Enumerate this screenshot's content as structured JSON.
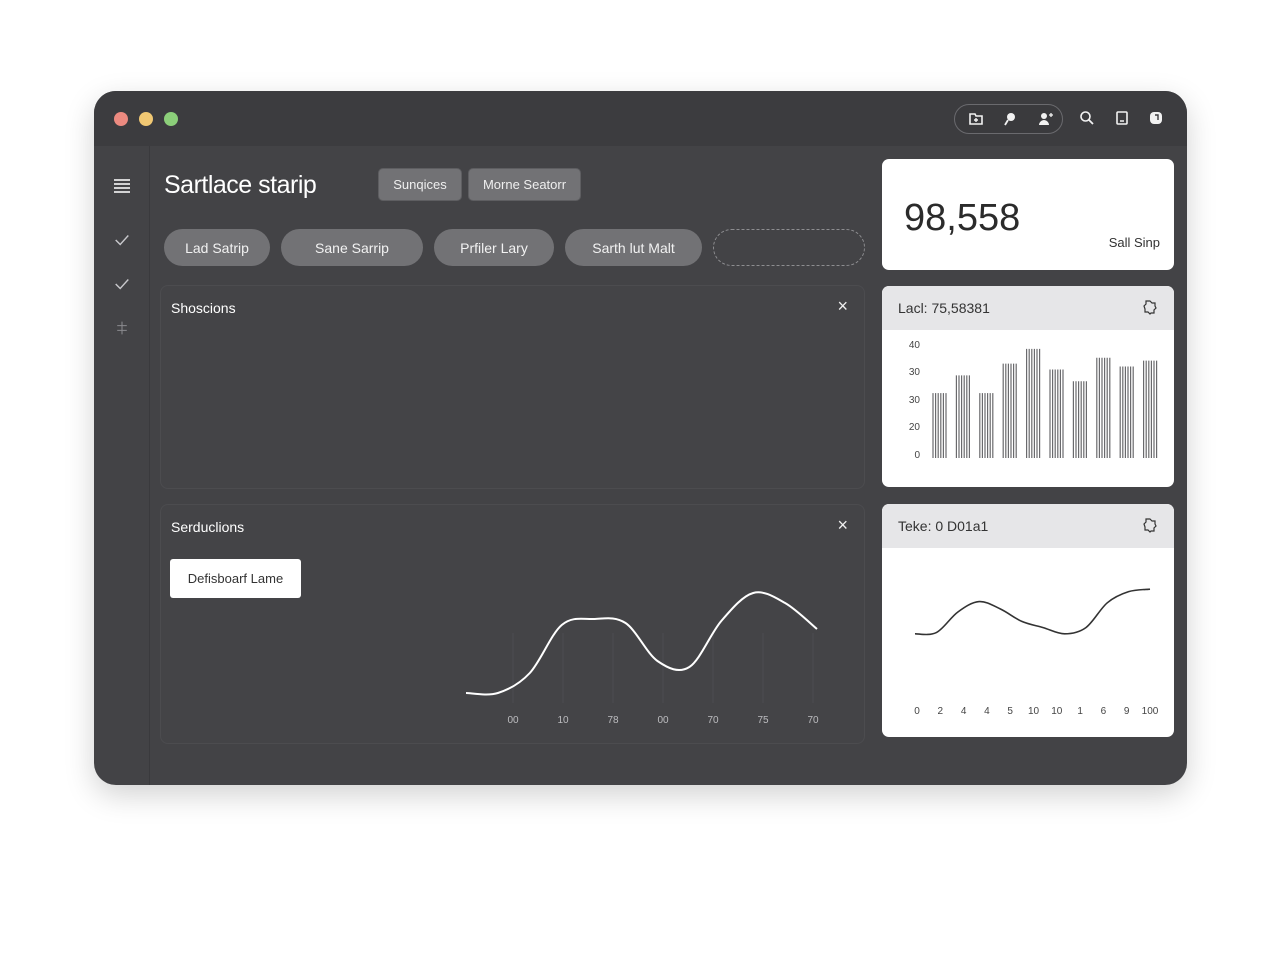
{
  "window": {
    "page_title": "Sartlace starip",
    "toolbar_buttons": [
      "Sunqices",
      "Morne Seatorr"
    ],
    "filter_pills": [
      "Lad Satrip",
      "Sane Sarrip",
      "Prfiler Lary",
      "Sarth lut Malt"
    ],
    "toolbar_icons": [
      "folder-icon",
      "chat-icon",
      "user-add-icon",
      "search-icon",
      "bookmark-icon",
      "notification-icon"
    ],
    "sidebar_icons": [
      "menu-icon",
      "check-icon",
      "check-icon",
      "split-icon"
    ]
  },
  "panels": {
    "top": {
      "title": "Shoscions",
      "close": "×"
    },
    "bottom": {
      "title": "Serduclions",
      "close": "×",
      "button_label": "Defisboarf Lame"
    }
  },
  "kpi": {
    "value": "98,558",
    "label": "Sall Sinp"
  },
  "bar_card": {
    "header": "Lacl: 75,58381"
  },
  "line_card": {
    "header": "Teke: 0 D01a1"
  },
  "chart_data": [
    {
      "type": "line",
      "x_tick_labels": [
        "00",
        "10",
        "78",
        "00",
        "70",
        "75",
        "70"
      ],
      "values": [
        0,
        0,
        0.2,
        0.68,
        0.74,
        0.7,
        0.32,
        0.26,
        0.72,
        1.0,
        0.9,
        0.64
      ],
      "ylim": [
        0,
        1
      ],
      "grid": true
    },
    {
      "type": "bar",
      "y_tick_labels": [
        "40",
        "30",
        "30",
        "20",
        "0"
      ],
      "values": [
        22,
        28,
        22,
        32,
        37,
        30,
        26,
        34,
        31,
        33
      ],
      "ylim": [
        0,
        40
      ]
    },
    {
      "type": "line",
      "x_tick_labels": [
        "0",
        "2",
        "4",
        "4",
        "5",
        "10",
        "10",
        "1",
        "6",
        "9",
        "100"
      ],
      "values": [
        0.1,
        0.12,
        0.45,
        0.62,
        0.5,
        0.3,
        0.2,
        0.1,
        0.2,
        0.6,
        0.78,
        0.82
      ],
      "ylim": [
        0,
        1
      ]
    }
  ],
  "colors": {
    "window_bg": "#434346",
    "titlebar_bg": "#3c3c3f",
    "pill_bg": "#727275",
    "card_bg": "#ffffff"
  }
}
